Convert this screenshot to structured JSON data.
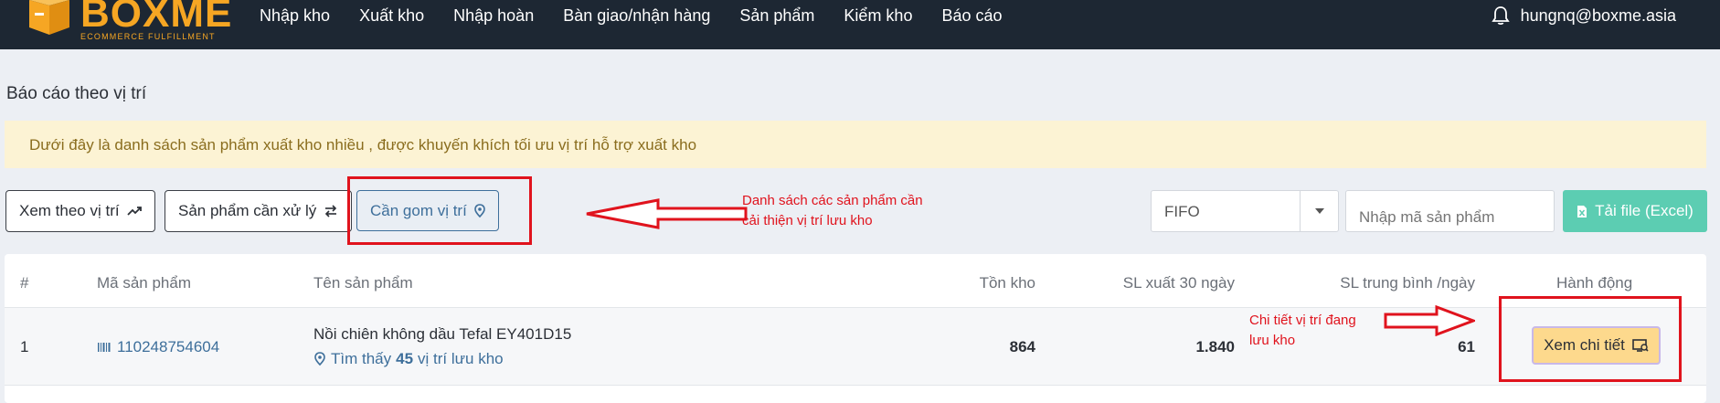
{
  "brand": {
    "name": "BOXME",
    "tagline": "ECOMMERCE FULFILLMENT",
    "color": "#f6a623"
  },
  "nav": {
    "items": [
      "Nhập kho",
      "Xuất kho",
      "Nhập hoàn",
      "Bàn giao/nhận hàng",
      "Sản phẩm",
      "Kiểm kho",
      "Báo cáo"
    ]
  },
  "user": {
    "email": "hungnq@boxme.asia",
    "icon": "bell-icon"
  },
  "page": {
    "title": "Báo cáo theo vị trí",
    "notice": "Dưới đây là danh sách sản phẩm xuất kho nhiều , được khuyến khích tối ưu vị trí hỗ trợ xuất kho"
  },
  "toolbar": {
    "view_by_location": "Xem theo vị trí",
    "products_to_process": "Sản phẩm cần xử lý",
    "consolidate_location": "Cần gom vị trí",
    "sort_select": "FIFO",
    "search_placeholder": "Nhập mã sản phẩm",
    "download_excel": "Tải file (Excel)"
  },
  "annotations": {
    "consolidate_note_line1": "Danh sách các sản phẩm cần",
    "consolidate_note_line2": "cải thiện vị trí lưu kho",
    "detail_note_line1": "Chi tiết vị trí đang",
    "detail_note_line2": "lưu kho",
    "color": "#e0131d"
  },
  "table": {
    "headers": {
      "index": "#",
      "sku": "Mã sản phẩm",
      "name": "Tên sản phẩm",
      "stock": "Tồn kho",
      "out_30d": "SL xuất 30 ngày",
      "avg_per_day": "SL trung bình /ngày",
      "action": "Hành động"
    },
    "rows": [
      {
        "index": "1",
        "sku": "110248754604",
        "name": "Nồi chiên không dầu Tefal EY401D15",
        "found_prefix": "Tìm thấy",
        "found_count": "45",
        "found_suffix": "vị trí lưu kho",
        "stock": "864",
        "out_30d": "1.840",
        "avg_per_day": "61",
        "action_label": "Xem chi tiết"
      }
    ]
  }
}
